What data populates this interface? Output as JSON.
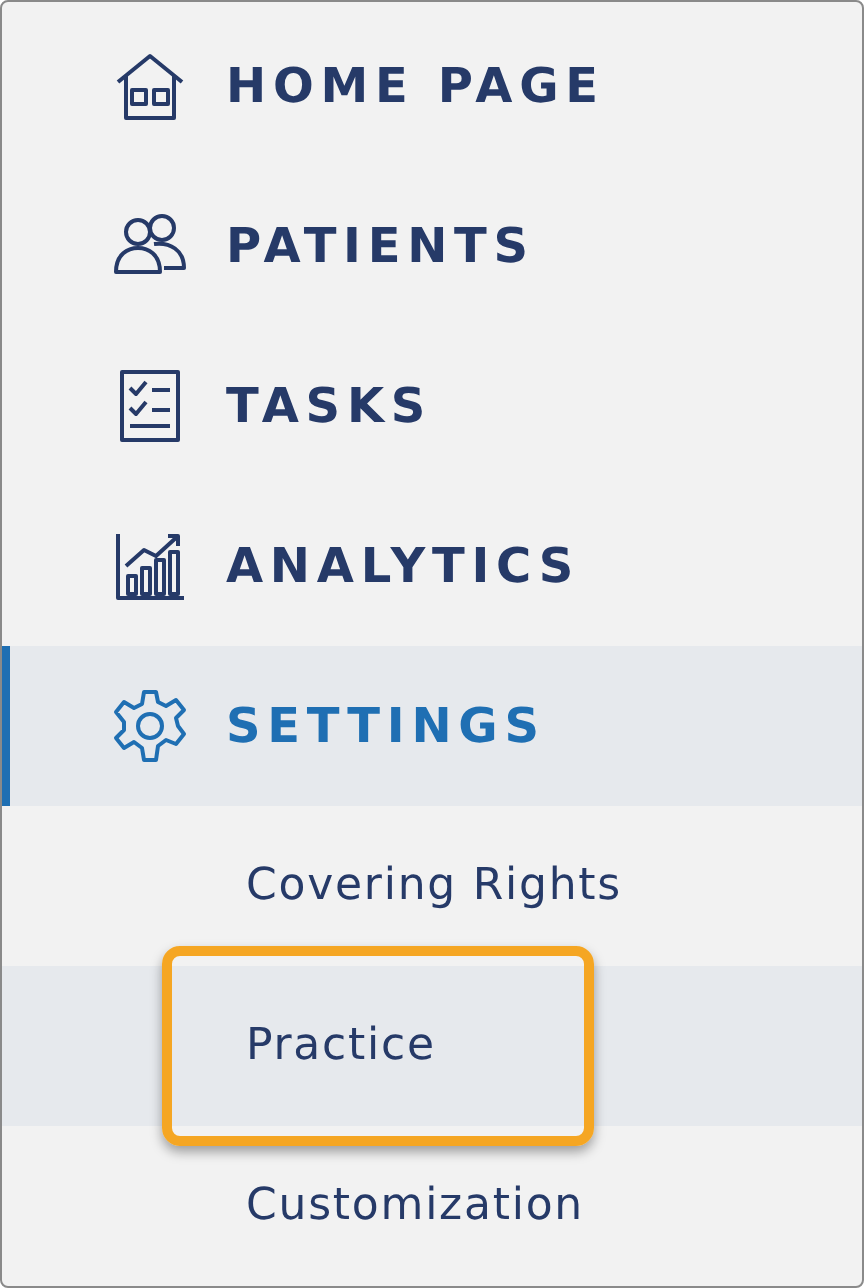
{
  "nav": [
    {
      "label": "HOME PAGE",
      "kind": "house",
      "selected": false
    },
    {
      "label": "PATIENTS",
      "kind": "people",
      "selected": false
    },
    {
      "label": "TASKS",
      "kind": "checklist",
      "selected": false
    },
    {
      "label": "ANALYTICS",
      "kind": "chart",
      "selected": false
    },
    {
      "label": "SETTINGS",
      "kind": "gear",
      "selected": true
    }
  ],
  "subitems": [
    {
      "label": "Covering Rights",
      "selected": false,
      "highlighted": false
    },
    {
      "label": "Practice",
      "selected": true,
      "highlighted": true
    },
    {
      "label": "Customization",
      "selected": false,
      "highlighted": false
    }
  ]
}
